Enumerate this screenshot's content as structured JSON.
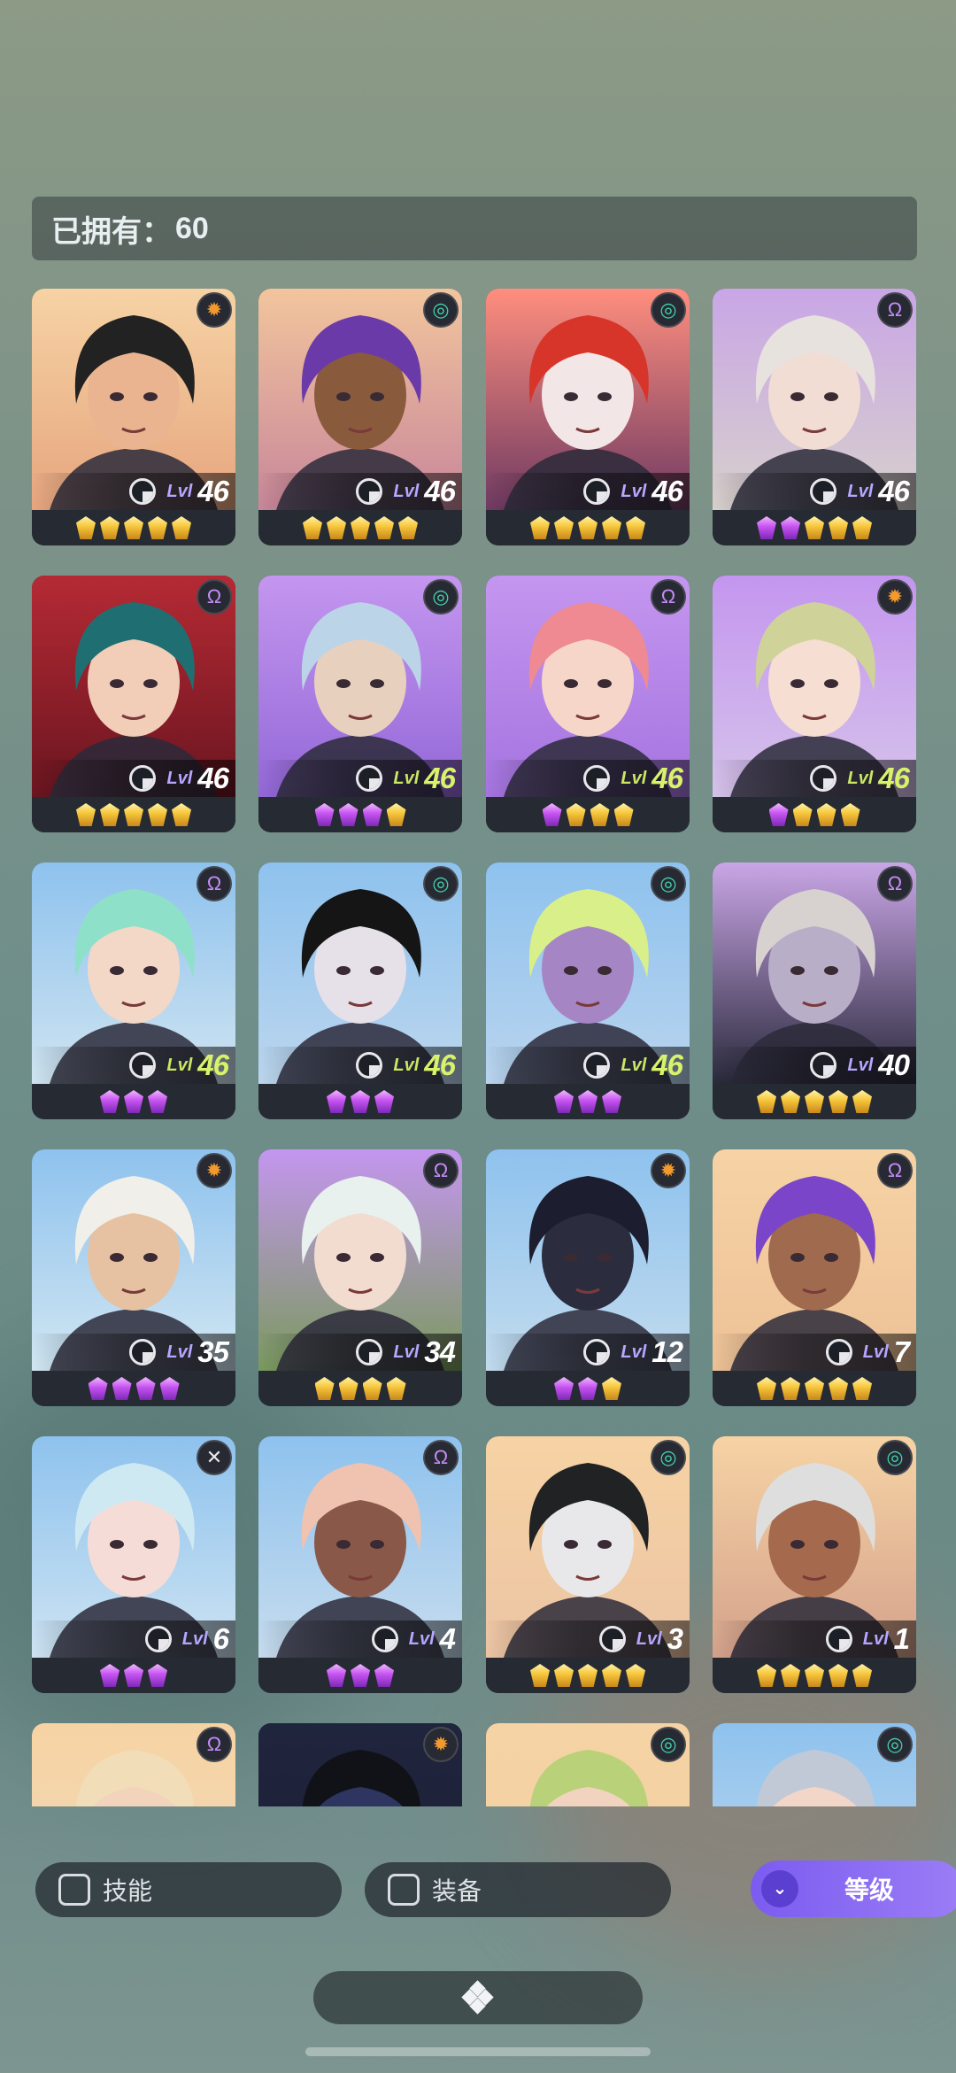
{
  "owned": {
    "label": "已拥有：",
    "count": "60"
  },
  "cards": [
    {
      "level": "46",
      "lvl_prefix": "Lvl",
      "class": "sun",
      "gems": [
        "gold",
        "gold",
        "gold",
        "gold",
        "gold"
      ],
      "bg": [
        "#f6d3a4",
        "#e7a57f"
      ],
      "hair": "#222222",
      "skin": "#e9b48f",
      "green": false
    },
    {
      "level": "46",
      "lvl_prefix": "Lvl",
      "class": "swirl",
      "gems": [
        "gold",
        "gold",
        "gold",
        "gold",
        "gold"
      ],
      "bg": [
        "#f2c59d",
        "#c8869a"
      ],
      "hair": "#6a3aa8",
      "skin": "#8a5a3c",
      "green": false
    },
    {
      "level": "46",
      "lvl_prefix": "Lvl",
      "class": "swirl",
      "gems": [
        "gold",
        "gold",
        "gold",
        "gold",
        "gold"
      ],
      "bg": [
        "#ff8e7e",
        "#6f3a62"
      ],
      "hair": "#d8352a",
      "skin": "#f3e6e6",
      "green": false
    },
    {
      "level": "46",
      "lvl_prefix": "Lvl",
      "class": "mystic",
      "gems": [
        "purple",
        "purple",
        "gold",
        "gold",
        "gold"
      ],
      "bg": [
        "#c9a6e6",
        "#d7d0cc"
      ],
      "hair": "#e7e2de",
      "skin": "#f2ddd4",
      "green": false
    },
    {
      "level": "46",
      "lvl_prefix": "Lvl",
      "class": "mystic",
      "gems": [
        "gold",
        "gold",
        "gold",
        "gold",
        "gold"
      ],
      "bg": [
        "#b52a34",
        "#6a1520"
      ],
      "hair": "#1f6f72",
      "skin": "#f2cdb8",
      "green": false
    },
    {
      "level": "46",
      "lvl_prefix": "Lvl",
      "class": "swirl",
      "gems": [
        "purple",
        "purple",
        "purple",
        "gold"
      ],
      "bg": [
        "#c496ef",
        "#9368d8"
      ],
      "hair": "#bcd4e8",
      "skin": "#e8d0bf",
      "green": true
    },
    {
      "level": "46",
      "lvl_prefix": "Lvl",
      "class": "mystic",
      "gems": [
        "purple",
        "gold",
        "gold",
        "gold"
      ],
      "bg": [
        "#c496ef",
        "#a574e0"
      ],
      "hair": "#ef8a92",
      "skin": "#f6d6c8",
      "green": true
    },
    {
      "level": "46",
      "lvl_prefix": "Lvl",
      "class": "sun",
      "gems": [
        "purple",
        "gold",
        "gold",
        "gold"
      ],
      "bg": [
        "#c496ef",
        "#d5c2ea"
      ],
      "hair": "#cfd39a",
      "skin": "#f6ded2",
      "green": true
    },
    {
      "level": "46",
      "lvl_prefix": "Lvl",
      "class": "mystic",
      "gems": [
        "purple",
        "purple",
        "purple"
      ],
      "bg": [
        "#8ec2ee",
        "#cfe4f0"
      ],
      "hair": "#8fe0c8",
      "skin": "#f3d8c7",
      "green": true
    },
    {
      "level": "46",
      "lvl_prefix": "Lvl",
      "class": "swirl",
      "gems": [
        "purple",
        "purple",
        "purple"
      ],
      "bg": [
        "#8ec2ee",
        "#bcd6ee"
      ],
      "hair": "#151515",
      "skin": "#e6e0e8",
      "green": true
    },
    {
      "level": "46",
      "lvl_prefix": "Lvl",
      "class": "swirl",
      "gems": [
        "purple",
        "purple",
        "purple"
      ],
      "bg": [
        "#8ec2ee",
        "#b9d4ee"
      ],
      "hair": "#d9ef8a",
      "skin": "#a585c4",
      "green": true
    },
    {
      "level": "40",
      "lvl_prefix": "Lvl",
      "class": "mystic",
      "gems": [
        "gold",
        "gold",
        "gold",
        "gold",
        "gold"
      ],
      "bg": [
        "#c9a6e6",
        "#2a2a3c"
      ],
      "hair": "#d7d2d0",
      "skin": "#b9aec8",
      "green": false
    },
    {
      "level": "35",
      "lvl_prefix": "Lvl",
      "class": "sun",
      "gems": [
        "purple",
        "purple",
        "purple",
        "purple"
      ],
      "bg": [
        "#8ec2ee",
        "#d1e6f2"
      ],
      "hair": "#f1efe9",
      "skin": "#e6c2a2",
      "green": false
    },
    {
      "level": "34",
      "lvl_prefix": "Lvl",
      "class": "mystic",
      "gems": [
        "gold",
        "gold",
        "gold",
        "gold"
      ],
      "bg": [
        "#c496ef",
        "#7a9a5e"
      ],
      "hair": "#e8f1ee",
      "skin": "#f2dccf",
      "green": false
    },
    {
      "level": "12",
      "lvl_prefix": "Lvl",
      "class": "sun",
      "gems": [
        "purple",
        "purple",
        "gold"
      ],
      "bg": [
        "#8ec2ee",
        "#c2dbee"
      ],
      "hair": "#1c1d2e",
      "skin": "#2b2d3e",
      "green": false
    },
    {
      "level": "7",
      "lvl_prefix": "Lvl",
      "class": "mystic",
      "gems": [
        "gold",
        "gold",
        "gold",
        "gold",
        "gold"
      ],
      "bg": [
        "#f6d3a4",
        "#edc197"
      ],
      "hair": "#7a45c9",
      "skin": "#a06a4e",
      "green": false
    },
    {
      "level": "6",
      "lvl_prefix": "Lvl",
      "class": "cross",
      "gems": [
        "purple",
        "purple",
        "purple"
      ],
      "bg": [
        "#8ec2ee",
        "#cde3f2"
      ],
      "hair": "#cfe9f2",
      "skin": "#f6dcd6",
      "green": false
    },
    {
      "level": "4",
      "lvl_prefix": "Lvl",
      "class": "mystic",
      "gems": [
        "purple",
        "purple",
        "purple"
      ],
      "bg": [
        "#8ec2ee",
        "#c7dcee"
      ],
      "hair": "#f0c2b0",
      "skin": "#8a5848",
      "green": false
    },
    {
      "level": "3",
      "lvl_prefix": "Lvl",
      "class": "swirl",
      "gems": [
        "gold",
        "gold",
        "gold",
        "gold",
        "gold"
      ],
      "bg": [
        "#f6d3a4",
        "#ecc4a4"
      ],
      "hair": "#202224",
      "skin": "#e8e8ea",
      "green": false
    },
    {
      "level": "1",
      "lvl_prefix": "Lvl",
      "class": "swirl",
      "gems": [
        "gold",
        "gold",
        "gold",
        "gold",
        "gold"
      ],
      "bg": [
        "#f6d3a4",
        "#d5a28c"
      ],
      "hair": "#dedede",
      "skin": "#a56a4e",
      "green": false
    },
    {
      "level": "",
      "lvl_prefix": "",
      "class": "mystic",
      "gems": [],
      "bg": [
        "#f6d3a4",
        "#f2d9b8"
      ],
      "hair": "#f1ddb8",
      "skin": "#f2d4bd",
      "green": false
    },
    {
      "level": "",
      "lvl_prefix": "",
      "class": "sun",
      "gems": [],
      "bg": [
        "#20253e",
        "#1a1e33"
      ],
      "hair": "#101218",
      "skin": "#2d3560",
      "green": false
    },
    {
      "level": "",
      "lvl_prefix": "",
      "class": "swirl",
      "gems": [],
      "bg": [
        "#f6d3a4",
        "#f0d0a4"
      ],
      "hair": "#b9d27a",
      "skin": "#f2d3c0",
      "green": false
    },
    {
      "level": "",
      "lvl_prefix": "",
      "class": "swirl",
      "gems": [],
      "bg": [
        "#8ec2ee",
        "#c3dbef"
      ],
      "hair": "#c2c9d6",
      "skin": "#f2d6c8",
      "green": false
    }
  ],
  "filters": {
    "skill_label": "技能",
    "equip_label": "装备",
    "sort_label": "等级",
    "sort_icon": "double-chevron-down-icon"
  },
  "bottom": {
    "menu_icon": "four-diamonds-menu-icon"
  },
  "colors": {
    "gold_gem": "#f6c53b",
    "purple_gem": "#c653f0",
    "sort_accent": "#8b6ef3",
    "class_sun": "#f29a2e",
    "class_swirl": "#43d1ad",
    "class_mystic": "#c58cf6"
  }
}
